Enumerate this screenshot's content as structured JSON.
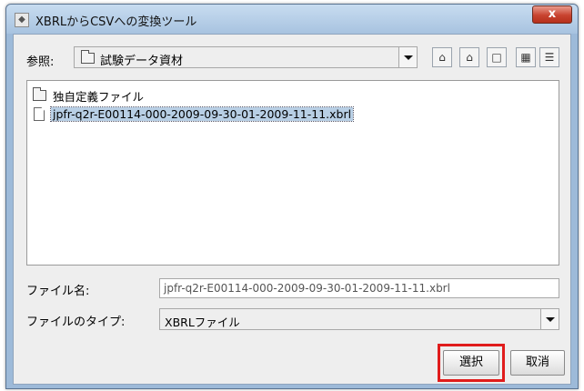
{
  "window": {
    "title": "XBRLからCSVへの変換ツール",
    "close_label": "x"
  },
  "lookin": {
    "label": "参照:",
    "value": "試験データ資材"
  },
  "toolbar": {
    "icons": [
      "up-folder-icon",
      "home-icon",
      "new-folder-icon",
      "list-view-icon",
      "details-view-icon"
    ]
  },
  "files": [
    {
      "type": "folder",
      "name": "独自定義ファイル"
    },
    {
      "type": "file",
      "name": "jpfr-q2r-E00114-000-2009-09-30-01-2009-11-11.xbrl",
      "selected": true
    }
  ],
  "filename": {
    "label": "ファイル名:",
    "value": "jpfr-q2r-E00114-000-2009-09-30-01-2009-11-11.xbrl"
  },
  "filetype": {
    "label": "ファイルのタイプ:",
    "value": "XBRLファイル"
  },
  "buttons": {
    "select": "選択",
    "cancel": "取消"
  },
  "colors": {
    "highlight": "#e01c1c",
    "selection": "#b8cfe5",
    "titlebar": "#a8c3e0"
  }
}
